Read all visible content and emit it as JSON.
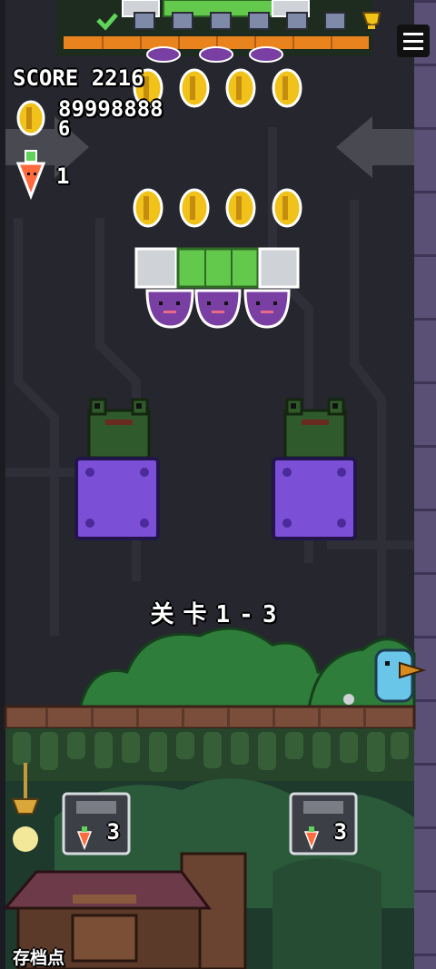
{
  "hud": {
    "score_label": "SCORE",
    "score_value": "2216",
    "coins": "89998888",
    "lives": "6",
    "carrots": "1"
  },
  "level": {
    "title": "关卡1-3"
  },
  "checkpoint": {
    "label": "存档点"
  },
  "save_slots": [
    {
      "count": "3"
    },
    {
      "count": "3"
    }
  ],
  "progress": {
    "fraction": 0.35
  },
  "colors": {
    "coin": "#f0c21a",
    "block_purple": "#7b4fd6",
    "frog_green": "#2f5a2c",
    "green_block": "#63c94c",
    "progress_orange": "#e8831e"
  },
  "icons": {
    "menu": "hamburger-icon",
    "trophy": "trophy-icon",
    "coin": "coin-icon",
    "carrot": "carrot-icon"
  }
}
